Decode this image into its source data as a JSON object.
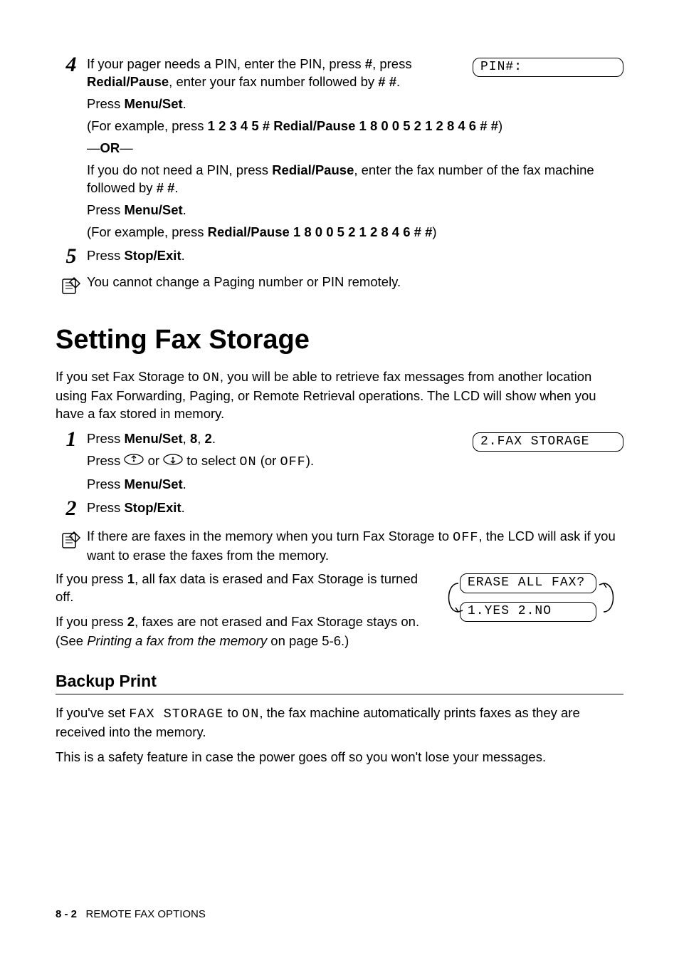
{
  "lcd_pin": "PIN#:",
  "step4": {
    "num": "4",
    "line1_a": "If your pager needs a PIN, enter the PIN, press ",
    "line1_b": "#",
    "line1_c": ", press ",
    "line1_d": "Redial/Pause",
    "line1_e": ", enter your fax number followed by ",
    "line1_f": "# #",
    "line1_g": ".",
    "press_menu_set_a": "Press ",
    "press_menu_set_b": "Menu/Set",
    "press_menu_set_c": ".",
    "example1_a": "(For example, press ",
    "example1_b": "1 2 3 4 5 # Redial/Pause 1 8 0 0 5 2 1 2 8 4 6 # #",
    "example1_c": ")",
    "or_a": "—",
    "or_b": "OR",
    "or_c": "—",
    "nopin_a": "If you do not need a PIN, press ",
    "nopin_b": "Redial/Pause",
    "nopin_c": ", enter the fax number of the fax machine followed by ",
    "nopin_d": "# #",
    "nopin_e": ".",
    "example2_a": "(For example, press ",
    "example2_b": "Redial/Pause 1 8 0 0 5 2 1 2 8 4 6 # #",
    "example2_c": ")"
  },
  "step5": {
    "num": "5",
    "a": "Press ",
    "b": "Stop/Exit",
    "c": "."
  },
  "note1": "You cannot change a Paging number or PIN remotely.",
  "heading_storage": "Setting Fax Storage",
  "storage_intro_a": "If you set Fax Storage to ",
  "storage_intro_on": "ON",
  "storage_intro_b": ", you will be able to retrieve fax messages from another location using Fax Forwarding, Paging, or Remote Retrieval operations. The LCD will show when you have a fax stored in memory.",
  "lcd_storage": "2.FAX STORAGE",
  "step1": {
    "num": "1",
    "line1_a": "Press ",
    "line1_b": "Menu/Set",
    "line1_c": ", ",
    "line1_d": "8",
    "line1_e": ", ",
    "line1_f": "2",
    "line1_g": ".",
    "line2_a": "Press ",
    "line2_b": " or ",
    "line2_c": " to select ",
    "line2_on": "ON",
    "line2_d": " (or ",
    "line2_off": "OFF",
    "line2_e": ").",
    "line3_a": "Press ",
    "line3_b": "Menu/Set",
    "line3_c": "."
  },
  "step2": {
    "num": "2",
    "a": "Press ",
    "b": "Stop/Exit",
    "c": "."
  },
  "note2_a": "If there are faxes in the memory when you turn Fax Storage to ",
  "note2_off": "OFF",
  "note2_b": ", the LCD will ask if you want to erase the faxes from the memory.",
  "press1_a": "If you press ",
  "press1_b": "1",
  "press1_c": ", all fax data is erased and Fax Storage is turned off.",
  "press2_a": "If you press ",
  "press2_b": "2",
  "press2_c": ", faxes are not erased and Fax Storage stays on.",
  "see_a": "(See ",
  "see_b": "Printing a fax from the memory",
  "see_c": " on page 5-6.)",
  "lcd_erase": "ERASE ALL FAX?",
  "lcd_yesno": "1.YES 2.NO",
  "backup_heading": "Backup Print",
  "backup_p1_a": "If you've set ",
  "backup_p1_b": "FAX STORAGE",
  "backup_p1_c": " to ",
  "backup_p1_d": "ON",
  "backup_p1_e": ", the fax machine automatically prints faxes as they are received into the memory.",
  "backup_p2": "This is a safety feature in case the power goes off so you won't lose your messages.",
  "footer_page": "8 - 2",
  "footer_title": "REMOTE FAX OPTIONS"
}
